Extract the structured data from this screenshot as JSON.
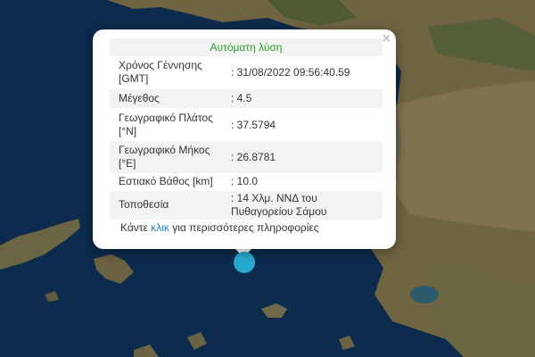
{
  "popup": {
    "title": "Αυτόματη λύση",
    "close_symbol": "×",
    "rows": [
      {
        "label_lines": [
          "Χρόνος Γέννησης",
          "[GMT]"
        ],
        "value_lines": [
          ": 31/08/2022 09:56:40.59"
        ]
      },
      {
        "label_lines": [
          "Μέγεθος"
        ],
        "value_lines": [
          ": 4.5"
        ]
      },
      {
        "label_lines": [
          "Γεωγραφικό Πλάτος",
          "[°N]"
        ],
        "value_lines": [
          ": 37.5794"
        ]
      },
      {
        "label_lines": [
          "Γεωγραφικό Μήκος",
          "[°E]"
        ],
        "value_lines": [
          ": 26.8781"
        ]
      },
      {
        "label_lines": [
          "Εστιακό Βάθος [km]"
        ],
        "value_lines": [
          ": 10.0"
        ]
      },
      {
        "label_lines": [
          "Τοποθεσία"
        ],
        "value_lines": [
          ": 14 Χλμ. ΝΝΔ του",
          "Πυθαγορείου Σάμου"
        ]
      }
    ],
    "more_prefix": "Κάντε ",
    "more_link": "κλικ",
    "more_suffix": " για περισσότερες πληροφορίες"
  },
  "colors": {
    "sea": "#0c2a4c",
    "land": "#7a6a45",
    "marker": "#29a7cf",
    "title_green": "#2a9a2a",
    "link": "#1a86c9"
  }
}
